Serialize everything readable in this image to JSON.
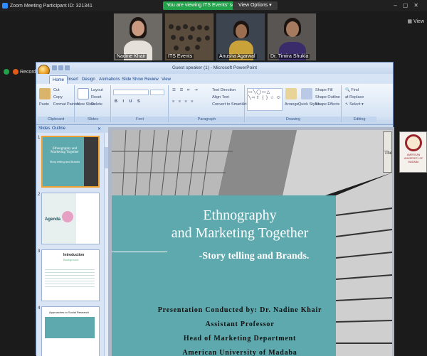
{
  "zoom": {
    "title": "Zoom Meeting Participant ID: 321341",
    "share_banner": "You are viewing ITS Events' screen",
    "view_options": "View Options",
    "view_link": "View",
    "recording_label": "Recordin",
    "participants": [
      {
        "name": "Nadine Khair"
      },
      {
        "name": "ITS Events"
      },
      {
        "name": "Anusha Agarwal"
      },
      {
        "name": "Dr. Timira Shukla"
      }
    ]
  },
  "powerpoint": {
    "window_title": "Guest speaker (1) - Microsoft PowerPoint",
    "tabs": [
      "Home",
      "Insert",
      "Design",
      "Animations",
      "Slide Show",
      "Review",
      "View"
    ],
    "active_tab": "Home",
    "ribbon": {
      "clipboard": {
        "label": "Clipboard",
        "paste": "Paste",
        "cut": "Cut",
        "copy": "Copy",
        "format_painter": "Format Painter"
      },
      "slides": {
        "label": "Slides",
        "new_slide": "New Slide",
        "layout": "Layout",
        "reset": "Reset",
        "delete": "Delete"
      },
      "font": {
        "label": "Font"
      },
      "paragraph": {
        "label": "Paragraph",
        "text_direction": "Text Direction",
        "align_text": "Align Text",
        "convert": "Convert to SmartArt"
      },
      "drawing": {
        "label": "Drawing",
        "arrange": "Arrange",
        "quick_styles": "Quick Styles",
        "shape_fill": "Shape Fill",
        "shape_outline": "Shape Outline",
        "shape_effects": "Shape Effects"
      },
      "editing": {
        "label": "Editing",
        "find": "Find",
        "replace": "Replace",
        "select": "Select"
      }
    },
    "pane_tabs": {
      "slides": "Slides",
      "outline": "Outline"
    },
    "thumbnails": [
      {
        "num": "1",
        "title": "Ethnography and Marketing Together",
        "sub": "Story telling and Brands"
      },
      {
        "num": "2",
        "title": "Agenda"
      },
      {
        "num": "3",
        "title": "Introduction",
        "sub": "Background"
      },
      {
        "num": "4",
        "title": "Approaches to Social Research"
      }
    ],
    "slide": {
      "title_line1": "Ethnography",
      "title_line2": "and Marketing Together",
      "subtitle": "-Story telling and Brands.",
      "presenter_line": "Presentation Conducted by: Dr. Nadine Khair",
      "role1": "Assistant Professor",
      "role2": "Head of Marketing Department",
      "org": "American University of Madaba"
    },
    "side_card": {
      "text": "AMERICAN UNIVERSITY OF MADABA",
      "partial": "The"
    }
  },
  "colors": {
    "teal": "#5ea9ae",
    "zoom_green": "#22a24b",
    "ribbon_blue": "#c9d9ee"
  }
}
